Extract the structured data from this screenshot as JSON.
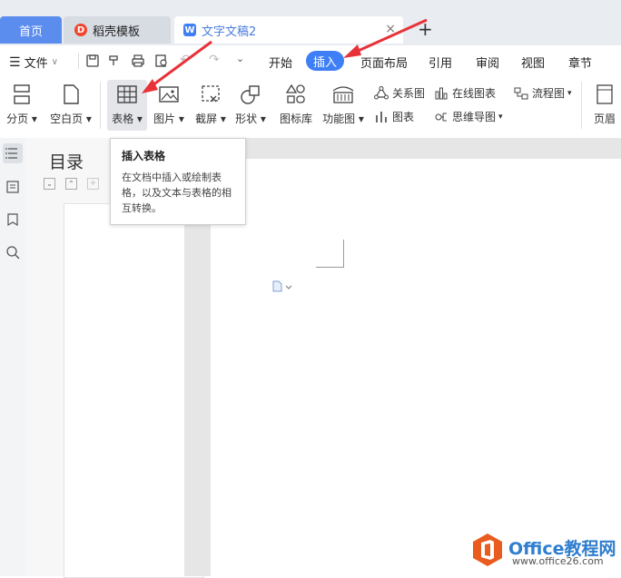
{
  "tabs": [
    {
      "label": "首页"
    },
    {
      "label": "稻壳模板",
      "icon": "daoke-icon"
    },
    {
      "label": "文字文稿2",
      "icon": "wps-writer-icon"
    }
  ],
  "tabbar": {
    "add_label": "+",
    "close_label": "×"
  },
  "menu": {
    "file": "文件",
    "items": [
      "开始",
      "插入",
      "页面布局",
      "引用",
      "审阅",
      "视图",
      "章节"
    ],
    "active": "插入"
  },
  "ribbon": {
    "page_break": "分页",
    "blank_page": "空白页",
    "table": "表格",
    "picture": "图片",
    "screenshot": "截屏",
    "shape": "形状",
    "icon_library": "图标库",
    "function_chart": "功能图",
    "relation_chart": "关系图",
    "online_chart": "在线图表",
    "flowchart": "流程图",
    "chart": "图表",
    "mind_map": "思维导图",
    "header_footer": "页眉"
  },
  "tooltip": {
    "title": "插入表格",
    "description": "在文档中插入或绘制表格，以及文本与表格的相互转换。"
  },
  "toc": {
    "title": "目录"
  },
  "watermark": {
    "brand": "Office教程网",
    "url": "www.office26.com"
  },
  "colors": {
    "accent": "#3f7ff5",
    "arrow": "#e8323a",
    "tab_home": "#5b8def"
  }
}
